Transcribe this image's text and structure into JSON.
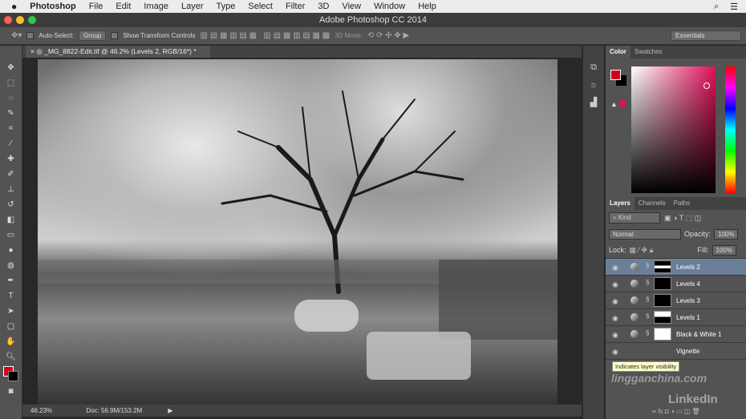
{
  "menubar": {
    "app": "Photoshop",
    "items": [
      "File",
      "Edit",
      "Image",
      "Layer",
      "Type",
      "Select",
      "Filter",
      "3D",
      "View",
      "Window",
      "Help"
    ]
  },
  "window": {
    "title": "Adobe Photoshop CC 2014"
  },
  "options": {
    "auto_select": "Auto-Select:",
    "group": "Group",
    "transform": "Show Transform Controls",
    "mode3d": "3D Mode:",
    "workspace": "Essentials"
  },
  "document": {
    "tab": "_MG_8822-Edit.tif @ 46.2% (Levels 2, RGB/16*) *",
    "zoom": "46.23%",
    "doc_size": "Doc: 56.9M/153.2M"
  },
  "color_panel": {
    "tabs": [
      "Color",
      "Swatches"
    ],
    "foreground": "#d0021b",
    "hue_color": "#e0105a"
  },
  "layers_panel": {
    "tabs": [
      "Layers",
      "Channels",
      "Paths"
    ],
    "filter": "Kind",
    "blend": "Normal",
    "opacity_label": "Opacity:",
    "opacity": "100%",
    "lock_label": "Lock:",
    "fill_label": "Fill:",
    "fill": "100%",
    "layers": [
      {
        "name": "Levels 2",
        "selected": true
      },
      {
        "name": "Levels 4"
      },
      {
        "name": "Levels 3"
      },
      {
        "name": "Levels 1"
      },
      {
        "name": "Black & White 1"
      },
      {
        "name": "Vignette"
      }
    ],
    "tooltip": "Indicates layer visibility"
  },
  "watermark": {
    "site": "lingganchina.com",
    "brand": "LinkedIn"
  }
}
